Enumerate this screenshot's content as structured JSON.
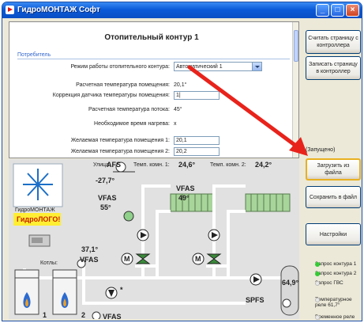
{
  "window": {
    "title": "ГидроМОНТАЖ Софт"
  },
  "panel": {
    "title": "Отопительный контур 1",
    "section": "Потребитель",
    "rows": [
      {
        "label": "Режим работы отопительного контура:",
        "value": "Автоматический 1"
      },
      {
        "label": "Расчетная температура помещения:",
        "value": "20,1°"
      },
      {
        "label": "Коррекция датчика температуры помещения:",
        "value": "1|"
      },
      {
        "label": "Расчетная температура потока:",
        "value": "45°"
      },
      {
        "label": "Необходимое время нагрева:",
        "value": "x"
      },
      {
        "label": "Желаемая температура помещения 1:",
        "value": "20,1"
      },
      {
        "label": "Желаемая температура помещения 2:",
        "value": "20,2"
      }
    ]
  },
  "buttons": {
    "read_page": "Считать страницу с контроллера",
    "write_page": "Записать страницу в контроллер",
    "load_file": "Загрузить из файла",
    "save_file": "Сохранить в файл",
    "settings": "Настройки"
  },
  "status_text": "(Запущено)",
  "scheme": {
    "logo_text": "ГидроМОНТАЖ",
    "brand_text": "ГидроЛОГО!",
    "afs_label": "Улица",
    "afs_name": "AFS",
    "afs_temp": "-27,7°",
    "room1_label": "Темп. комн. 1:",
    "room1_temp": "24,6°",
    "room2_label": "Темп. комн. 2:",
    "room2_temp": "24,2°",
    "vfas1_name": "VFAS",
    "vfas1_temp": "55°",
    "vfas2_name": "VFAS",
    "vfas2_temp": "49°",
    "vfas3_temp": "37,1°",
    "vfas3_name": "VFAS",
    "vfas4_name": "VFAS",
    "boilers_label": "Котлы:",
    "boiler1": "1",
    "boiler2": "2",
    "tank_temp": "64,9°",
    "spfs_name": "SPFS",
    "star": "*",
    "motor": "M"
  },
  "legend": [
    {
      "label": "Запрос контура 1",
      "color": "#33cc33"
    },
    {
      "label": "Запрос контура 2",
      "color": "#33cc33"
    },
    {
      "label": "Запрос ГВС",
      "color": "#e8e8e8"
    },
    {
      "label": "Температурное реле 61,7°",
      "color": "#e8e8e8"
    },
    {
      "label": "Временное реле",
      "color": "#e8e8e8"
    }
  ],
  "colors": {
    "accent": "#0b5ad9",
    "annotation_arrow": "#e8231b",
    "legend_active": "#33cc33"
  }
}
